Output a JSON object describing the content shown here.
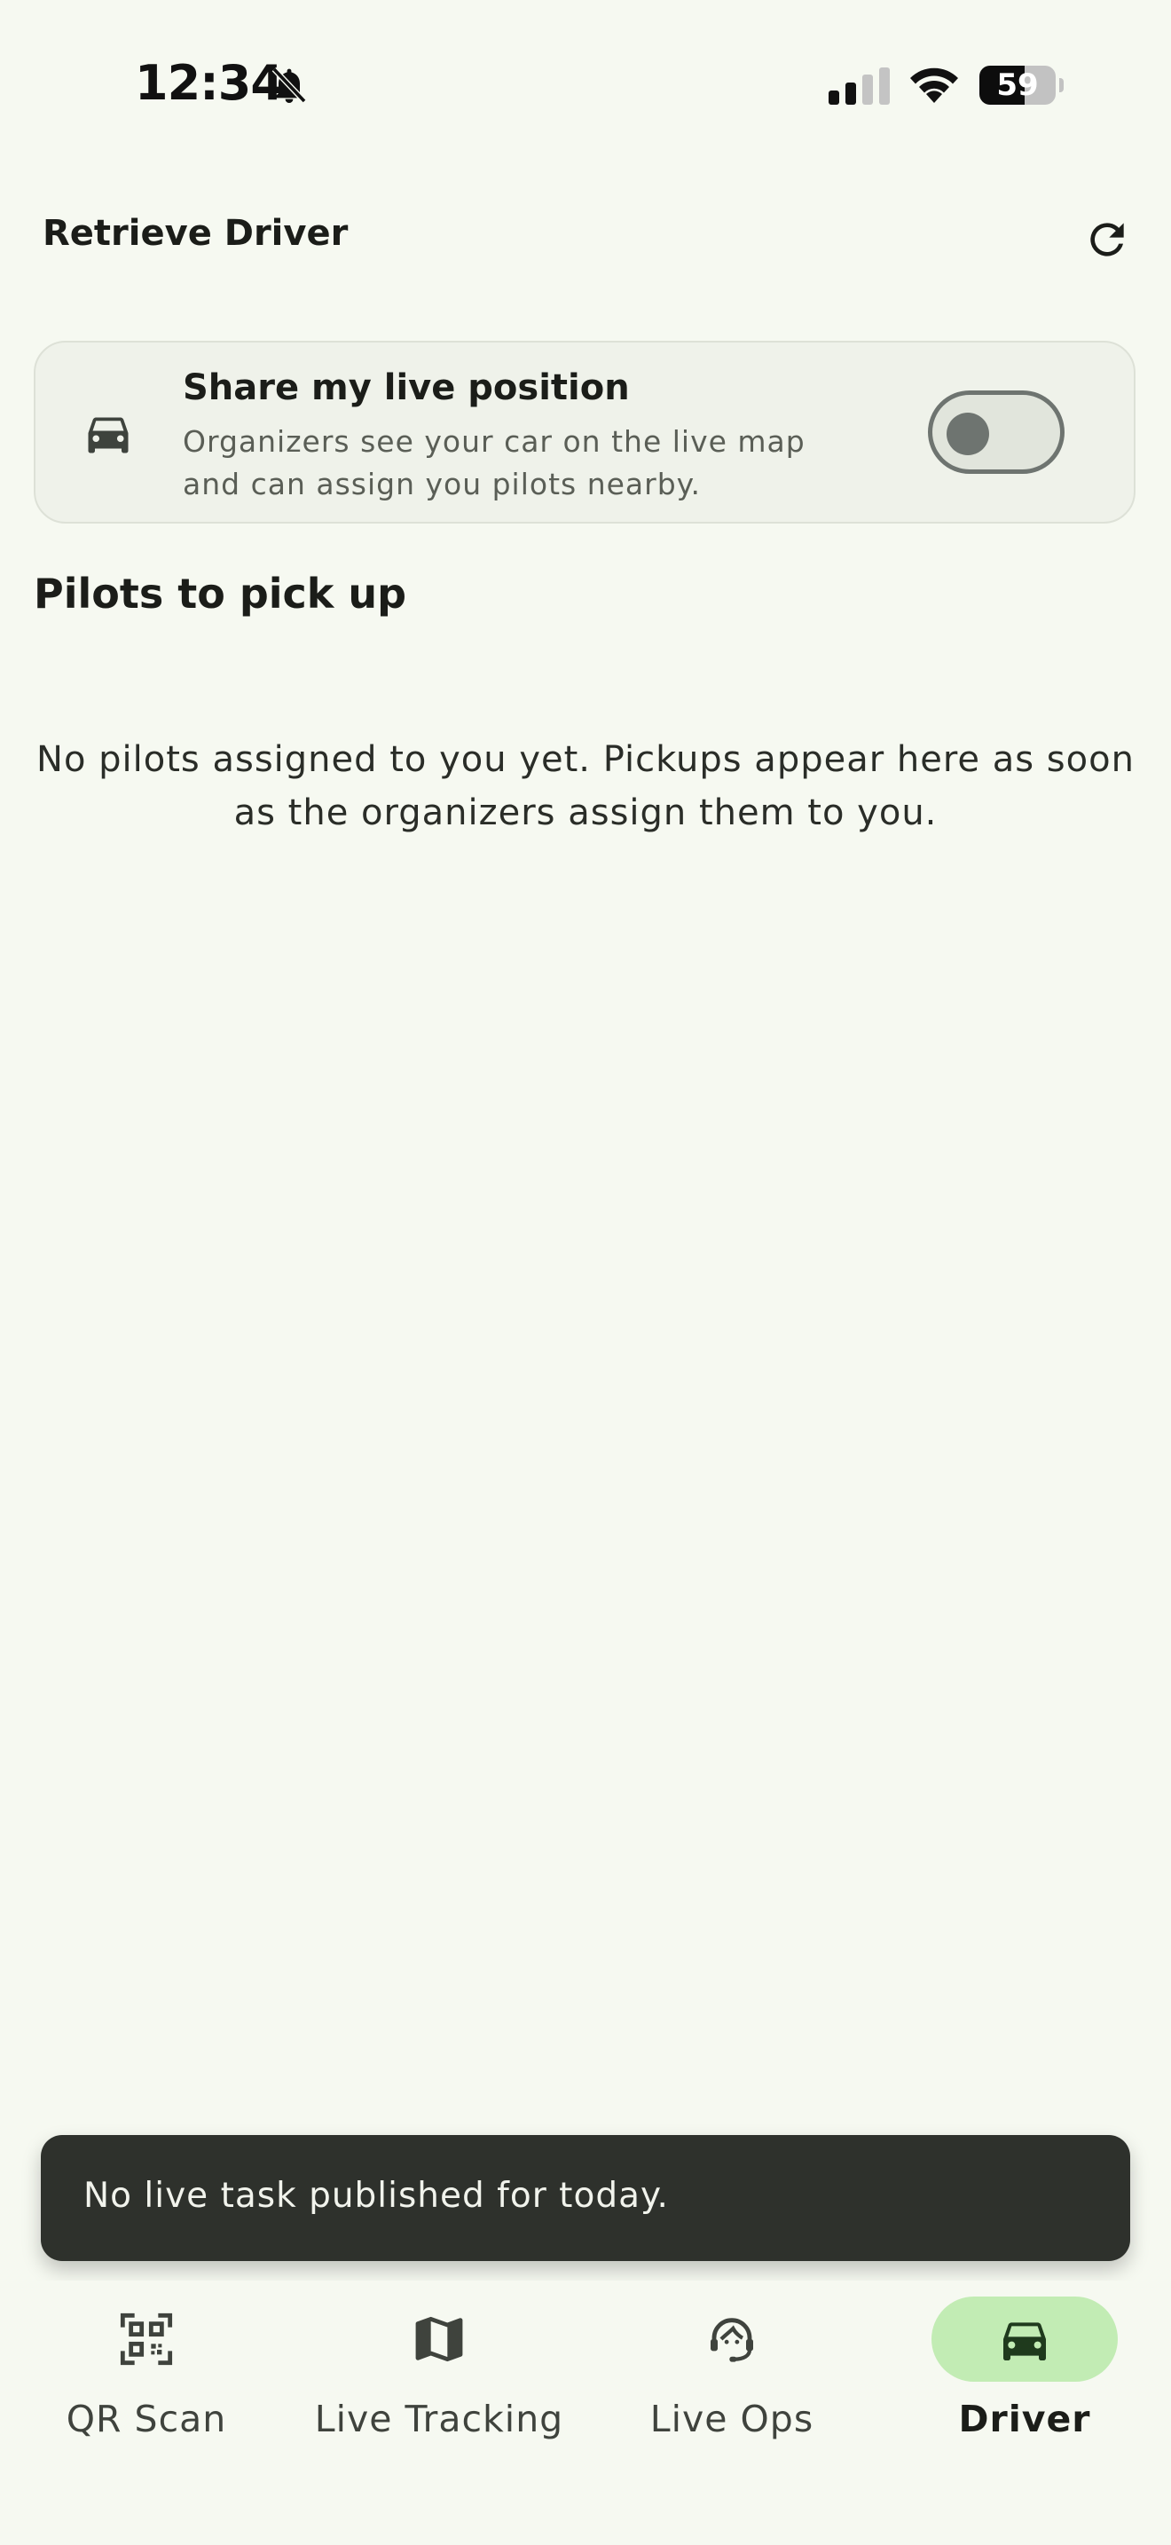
{
  "status_bar": {
    "time": "12:34",
    "battery_percent": 59,
    "battery_text": "59",
    "icons": [
      "bell-slash-icon",
      "cellular-signal-icon",
      "wifi-icon",
      "battery-icon"
    ]
  },
  "app_bar": {
    "title": "Retrieve Driver",
    "refresh_icon": "refresh-icon"
  },
  "share_card": {
    "icon": "car-icon",
    "title": "Share my live position",
    "description": "Organizers see your car on the live map and can assign you pilots nearby.",
    "toggle_on": false
  },
  "pilots_section": {
    "title": "Pilots to pick up",
    "empty_message": "No pilots assigned to you yet. Pickups appear here as soon as the organizers assign them to you."
  },
  "snackbar": {
    "message": "No live task published for today."
  },
  "bottom_nav": {
    "items": [
      {
        "label": "QR Scan",
        "icon": "qr-code-icon",
        "active": false
      },
      {
        "label": "Live Tracking",
        "icon": "map-icon",
        "active": false
      },
      {
        "label": "Live Ops",
        "icon": "support-agent-icon",
        "active": false
      },
      {
        "label": "Driver",
        "icon": "car-icon",
        "active": true
      }
    ]
  },
  "colors": {
    "background": "#f6f9f1",
    "card": "#eff2ea",
    "active_pill": "#c2ecb4",
    "snackbar": "#2e312c"
  }
}
